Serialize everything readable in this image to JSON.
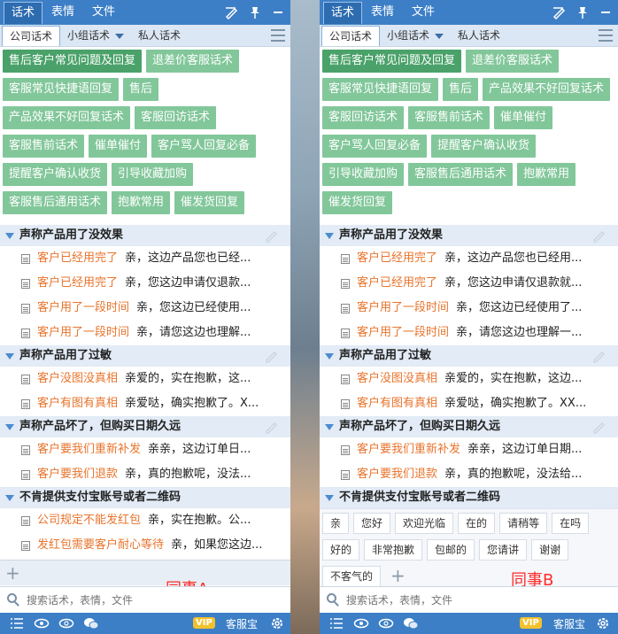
{
  "top_tabs": [
    "话术",
    "表情",
    "文件"
  ],
  "sub_tabs": [
    "公司话术",
    "小组话术",
    "私人话术"
  ],
  "chips": [
    "售后客户常见问题及回复",
    "退差价客服话术",
    "客服常见快捷语回复",
    "售后",
    "产品效果不好回复话术",
    "客服回访话术",
    "客服售前话术",
    "催单催付",
    "客户骂人回复必备",
    "提醒客户确认收货",
    "引导收藏加购",
    "客服售后通用话术",
    "抱歉常用",
    "催发货回复"
  ],
  "panel_a": {
    "groups": [
      {
        "title": "声称产品用了没效果",
        "items": [
          {
            "title": "客户已经用完了",
            "body": "亲，这边产品您也已经..."
          },
          {
            "title": "客户已经用完了",
            "body": "亲，您这边申请仅退款..."
          },
          {
            "title": "客户用了一段时间",
            "body": "亲，您这边已经使用..."
          },
          {
            "title": "客户用了一段时间",
            "body": "亲，请您这边也理解..."
          }
        ]
      },
      {
        "title": "声称产品用了过敏",
        "items": [
          {
            "title": "客户没图没真相",
            "body": "亲爱的，实在抱歉，这..."
          },
          {
            "title": "客户有图有真相",
            "body": "亲爱哒，确实抱歉了。X..."
          }
        ]
      },
      {
        "title": "声称产品坏了，但购买日期久远",
        "items": [
          {
            "title": "客户要我们重新补发",
            "body": "亲亲，这边订单日..."
          },
          {
            "title": "客户要我们退款",
            "body": "亲，真的抱歉呢，没法..."
          }
        ]
      },
      {
        "title": "不肯提供支付宝账号或者二维码",
        "items": [
          {
            "title": "公司规定不能发红包",
            "body": "亲，实在抱歉。公..."
          },
          {
            "title": "发红包需要客户耐心等待",
            "body": "亲，如果您这边..."
          }
        ]
      }
    ],
    "label": "同事A"
  },
  "panel_b": {
    "groups": [
      {
        "title": "声称产品用了没效果",
        "items": [
          {
            "title": "客户已经用完了",
            "body": "亲，这边产品您也已经用..."
          },
          {
            "title": "客户已经用完了",
            "body": "亲，您这边申请仅退款就..."
          },
          {
            "title": "客户用了一段时间",
            "body": "亲，您这边已经使用了..."
          },
          {
            "title": "客户用了一段时间",
            "body": "亲，请您这边也理解一..."
          }
        ]
      },
      {
        "title": "声称产品用了过敏",
        "items": [
          {
            "title": "客户没图没真相",
            "body": "亲爱的，实在抱歉，这边..."
          },
          {
            "title": "客户有图有真相",
            "body": "亲爱哒，确实抱歉了。XX..."
          }
        ]
      },
      {
        "title": "声称产品坏了，但购买日期久远",
        "items": [
          {
            "title": "客户要我们重新补发",
            "body": "亲亲，这边订单日期..."
          },
          {
            "title": "客户要我们退款",
            "body": "亲，真的抱歉呢，没法给..."
          }
        ]
      }
    ],
    "partial_group": "不肯提供支付宝账号或者二维码",
    "quick_replies": [
      "亲",
      "您好",
      "欢迎光临",
      "在的",
      "请稍等",
      "在吗",
      "好的",
      "非常抱歉",
      "包邮的",
      "您请讲",
      "谢谢",
      "不客气的"
    ],
    "label": "同事B"
  },
  "search_placeholder": "搜索话术，表情，文件",
  "status": {
    "vip": "VIP",
    "app_name": "客服宝"
  },
  "colors": {
    "topbar": "#3d7fc6",
    "chip": "#82c79a",
    "chip_selected": "#4aa26a",
    "item_title": "#e8742c",
    "label": "#ff2a2a"
  }
}
